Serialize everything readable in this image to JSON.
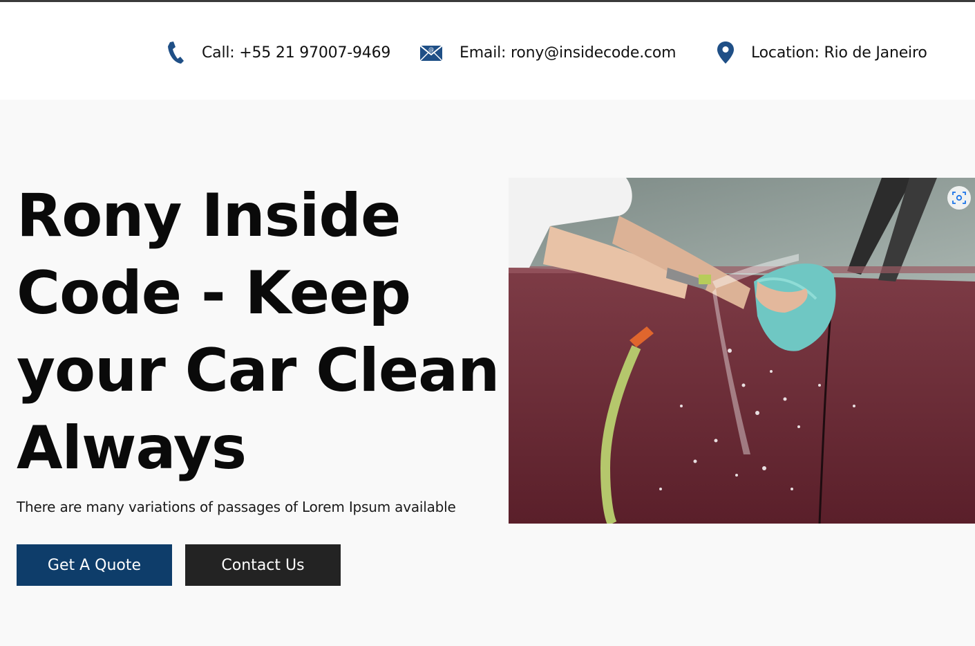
{
  "contact_bar": {
    "phone": {
      "icon": "phone-icon",
      "text": "Call: +55 21 97007-9469"
    },
    "email": {
      "icon": "envelope-icon",
      "text": "Email: rony@insidecode.com"
    },
    "location": {
      "icon": "map-pin-icon",
      "text": "Location: Rio de Janeiro"
    }
  },
  "hero": {
    "headline": "Rony Inside Code - Keep your Car Clean Always",
    "subtitle": "There are many variations of passages of Lorem Ipsum available",
    "buttons": {
      "quote_label": "Get A Quote",
      "contact_label": "Contact Us"
    },
    "image": {
      "alt": "Person washing a red car with a hose and a cloth"
    },
    "lens_icon": "visual-search-icon"
  },
  "colors": {
    "brand_blue": "#0e3d6a",
    "button_dark": "#232323",
    "icon_blue": "#1f4f86",
    "hero_bg": "#f9f9f9"
  }
}
